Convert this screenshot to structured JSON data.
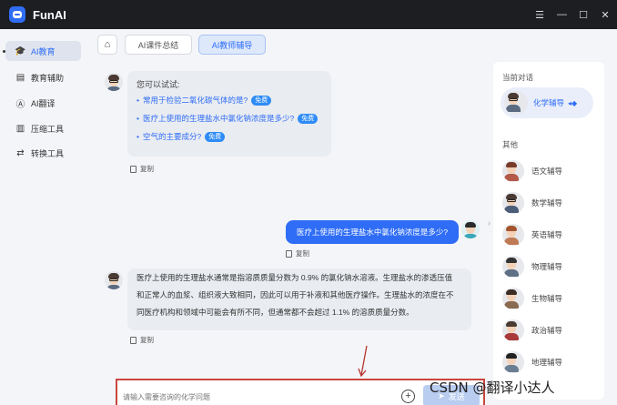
{
  "app": {
    "name": "FunAI"
  },
  "window_controls": {
    "menu_icon": "menu-icon",
    "minimize": "minimize-icon",
    "maximize": "maximize-icon",
    "close": "close-icon"
  },
  "sidebar": {
    "items": [
      {
        "label": "AI教育",
        "icon": "graduation-cap-icon",
        "active": true
      },
      {
        "label": "教育辅助",
        "icon": "book-icon"
      },
      {
        "label": "AI翻译",
        "icon": "translate-icon"
      },
      {
        "label": "压缩工具",
        "icon": "compress-icon"
      },
      {
        "label": "转换工具",
        "icon": "convert-icon"
      }
    ]
  },
  "tabs": [
    {
      "label": "AI课件总结"
    },
    {
      "label": "AI教师辅导",
      "active": true
    }
  ],
  "chat": {
    "suggestions_title": "您可以试试:",
    "suggestions": [
      {
        "text": "常用于检验二氧化碳气体的是?",
        "badge": "免费"
      },
      {
        "text": "医疗上使用的生理盐水中氯化钠浓度是多少?",
        "badge": "免费"
      },
      {
        "text": "空气的主要成分?",
        "badge": "免费"
      }
    ],
    "copy_label": "复制",
    "user_message": "医疗上使用的生理盐水中氯化钠浓度是多少?",
    "answer": "医疗上使用的生理盐水通常是指溶质质量分数为 0.9% 的氯化钠水溶液。生理盐水的渗透压值和正常人的血浆、组织液大致相同，因此可以用于补液和其他医疗操作。生理盐水的浓度在不同医疗机构和领域中可能会有所不同，但通常都不会超过 1.1% 的溶质质量分数。"
  },
  "input": {
    "placeholder": "请输入需要咨询的化学问题",
    "send_label": "发送"
  },
  "right_panel": {
    "current_label": "当前对话",
    "current_name": "化学辅导",
    "others_label": "其他",
    "others": [
      "语文辅导",
      "数学辅导",
      "英语辅导",
      "物理辅导",
      "生物辅导",
      "政治辅导",
      "地理辅导"
    ]
  },
  "watermark": "CSDN @翻译小达人",
  "colors": {
    "accent": "#2f6df6",
    "titlebar": "#1d1e22",
    "highlight_border": "#c9463f"
  }
}
